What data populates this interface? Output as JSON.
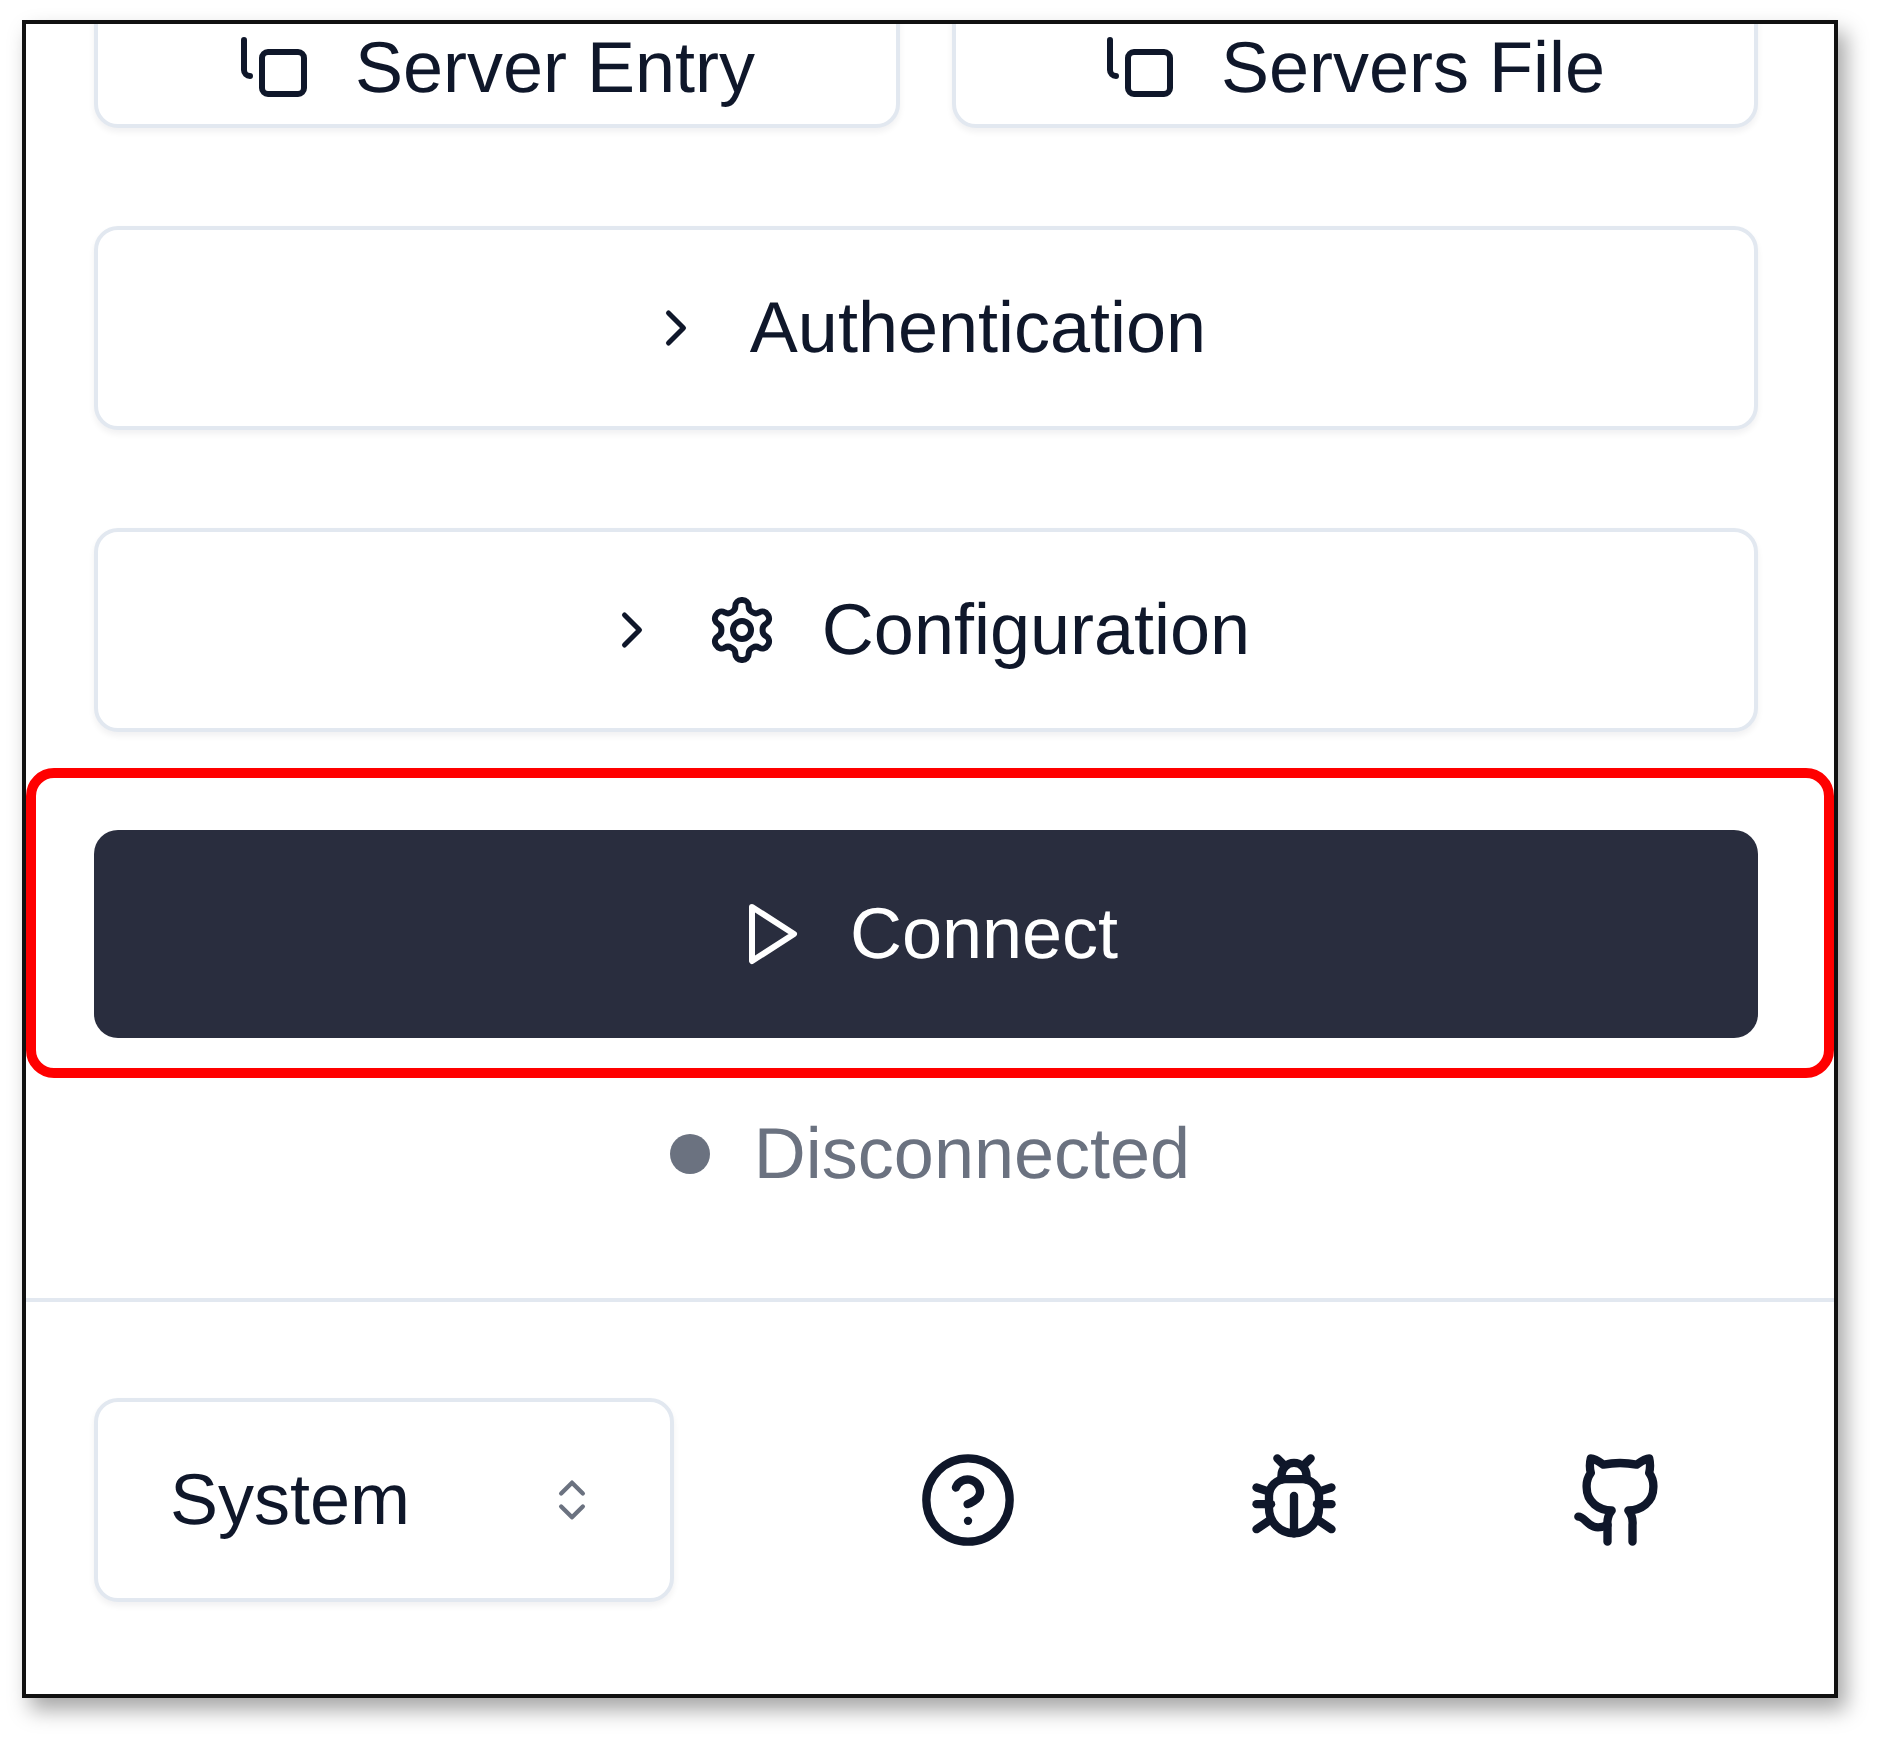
{
  "copy_buttons": [
    {
      "label": "Server Entry"
    },
    {
      "label": "Servers File"
    }
  ],
  "sections": [
    {
      "label": "Authentication",
      "expanded": false,
      "kind": "plain"
    },
    {
      "label": "Configuration",
      "expanded": false,
      "kind": "settings"
    }
  ],
  "connect_button": {
    "label": "Connect",
    "highlighted": true
  },
  "status": {
    "connected": false,
    "label": "Disconnected"
  },
  "theme_select": {
    "value": "System"
  },
  "footer_icons": [
    {
      "kind": "help"
    },
    {
      "kind": "bug"
    },
    {
      "kind": "cat"
    }
  ]
}
